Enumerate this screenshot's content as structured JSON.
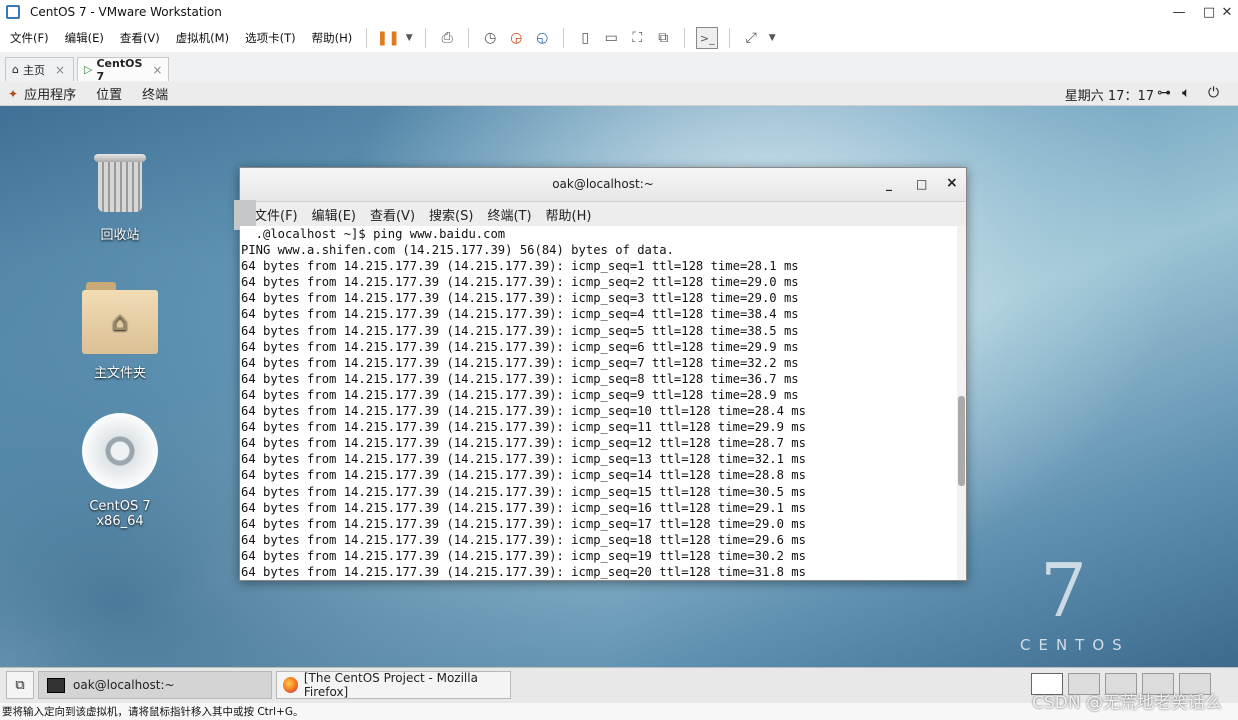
{
  "vmware": {
    "title": "CentOS 7 - VMware Workstation",
    "menus": [
      "文件(F)",
      "编辑(E)",
      "查看(V)",
      "虚拟机(M)",
      "选项卡(T)",
      "帮助(H)"
    ],
    "tabs": [
      {
        "label": "主页",
        "close": "×"
      },
      {
        "label": "CentOS 7",
        "close": "×"
      }
    ],
    "status_text": "要将输入定向到该虚拟机，请将鼠标指针移入其中或按 Ctrl+G。"
  },
  "gnome": {
    "menus": [
      "应用程序",
      "位置",
      "终端"
    ],
    "clock": "星期六 17：17"
  },
  "desktop": {
    "icons": [
      {
        "label": "回收站",
        "icon": "trash-icon"
      },
      {
        "label": "主文件夹",
        "icon": "home-folder-icon"
      },
      {
        "label": "CentOS 7 x86_64",
        "icon": "disc-icon"
      }
    ],
    "branding_number": "7",
    "branding_word": "CENTOS"
  },
  "terminal": {
    "title": "oak@localhost:~",
    "controls": {
      "minimize": "_",
      "maximize": "□",
      "close": "×"
    },
    "menus": [
      "文件(F)",
      "编辑(E)",
      "查看(V)",
      "搜索(S)",
      "终端(T)",
      "帮助(H)"
    ],
    "lines": [
      "  .@localhost ~]$ ping www.baidu.com",
      "PING www.a.shifen.com (14.215.177.39) 56(84) bytes of data.",
      "64 bytes from 14.215.177.39 (14.215.177.39): icmp_seq=1 ttl=128 time=28.1 ms",
      "64 bytes from 14.215.177.39 (14.215.177.39): icmp_seq=2 ttl=128 time=29.0 ms",
      "64 bytes from 14.215.177.39 (14.215.177.39): icmp_seq=3 ttl=128 time=29.0 ms",
      "64 bytes from 14.215.177.39 (14.215.177.39): icmp_seq=4 ttl=128 time=38.4 ms",
      "64 bytes from 14.215.177.39 (14.215.177.39): icmp_seq=5 ttl=128 time=38.5 ms",
      "64 bytes from 14.215.177.39 (14.215.177.39): icmp_seq=6 ttl=128 time=29.9 ms",
      "64 bytes from 14.215.177.39 (14.215.177.39): icmp_seq=7 ttl=128 time=32.2 ms",
      "64 bytes from 14.215.177.39 (14.215.177.39): icmp_seq=8 ttl=128 time=36.7 ms",
      "64 bytes from 14.215.177.39 (14.215.177.39): icmp_seq=9 ttl=128 time=28.9 ms",
      "64 bytes from 14.215.177.39 (14.215.177.39): icmp_seq=10 ttl=128 time=28.4 ms",
      "64 bytes from 14.215.177.39 (14.215.177.39): icmp_seq=11 ttl=128 time=29.9 ms",
      "64 bytes from 14.215.177.39 (14.215.177.39): icmp_seq=12 ttl=128 time=28.7 ms",
      "64 bytes from 14.215.177.39 (14.215.177.39): icmp_seq=13 ttl=128 time=32.1 ms",
      "64 bytes from 14.215.177.39 (14.215.177.39): icmp_seq=14 ttl=128 time=28.8 ms",
      "64 bytes from 14.215.177.39 (14.215.177.39): icmp_seq=15 ttl=128 time=30.5 ms",
      "64 bytes from 14.215.177.39 (14.215.177.39): icmp_seq=16 ttl=128 time=29.1 ms",
      "64 bytes from 14.215.177.39 (14.215.177.39): icmp_seq=17 ttl=128 time=29.0 ms",
      "64 bytes from 14.215.177.39 (14.215.177.39): icmp_seq=18 ttl=128 time=29.6 ms",
      "64 bytes from 14.215.177.39 (14.215.177.39): icmp_seq=19 ttl=128 time=30.2 ms",
      "64 bytes from 14.215.177.39 (14.215.177.39): icmp_seq=20 ttl=128 time=31.8 ms"
    ]
  },
  "taskbar": {
    "items": [
      {
        "label": "oak@localhost:~",
        "active": true
      },
      {
        "label": "[The CentOS Project - Mozilla Firefox]",
        "active": false
      }
    ]
  },
  "watermark": "CSDN @无荒地老笑话么"
}
